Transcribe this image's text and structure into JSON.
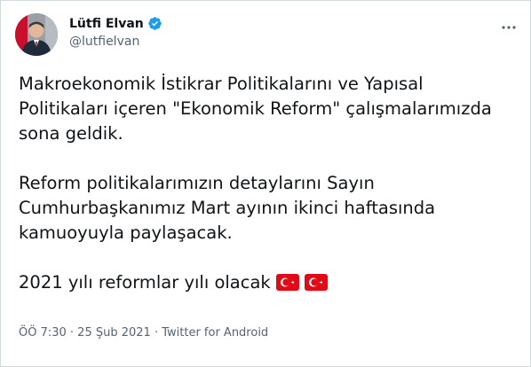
{
  "user": {
    "name": "Lütfi Elvan",
    "handle": "@lutfielvan",
    "verified_icon": "verified-badge-icon",
    "more_icon": "more-icon"
  },
  "tweet": {
    "paragraphs": [
      {
        "lines": [
          "Makroekonomik İstikrar Politikalarını ve Yapısal",
          "Politikaları içeren \"Ekonomik Reform\" çalışmalarımızda",
          "sona geldik."
        ]
      },
      {
        "lines": [
          "Reform politikalarımızın detaylarını Sayın",
          "Cumhurbaşkanımız Mart ayının ikinci haftasında",
          "kamuoyuyla paylaşacak."
        ]
      },
      {
        "lines": [
          "2021 yılı reformlar yılı olacak"
        ]
      }
    ],
    "emoji": [
      "turkey-flag",
      "turkey-flag"
    ]
  },
  "meta": {
    "text": "ÖÖ 7:30 · 25 Şub 2021 · Twitter for Android"
  },
  "colors": {
    "text": "#0f1419",
    "secondary": "#536471",
    "verified": "#1d9bf0",
    "flag_red": "#e30a17",
    "border": "#cfd9de"
  }
}
